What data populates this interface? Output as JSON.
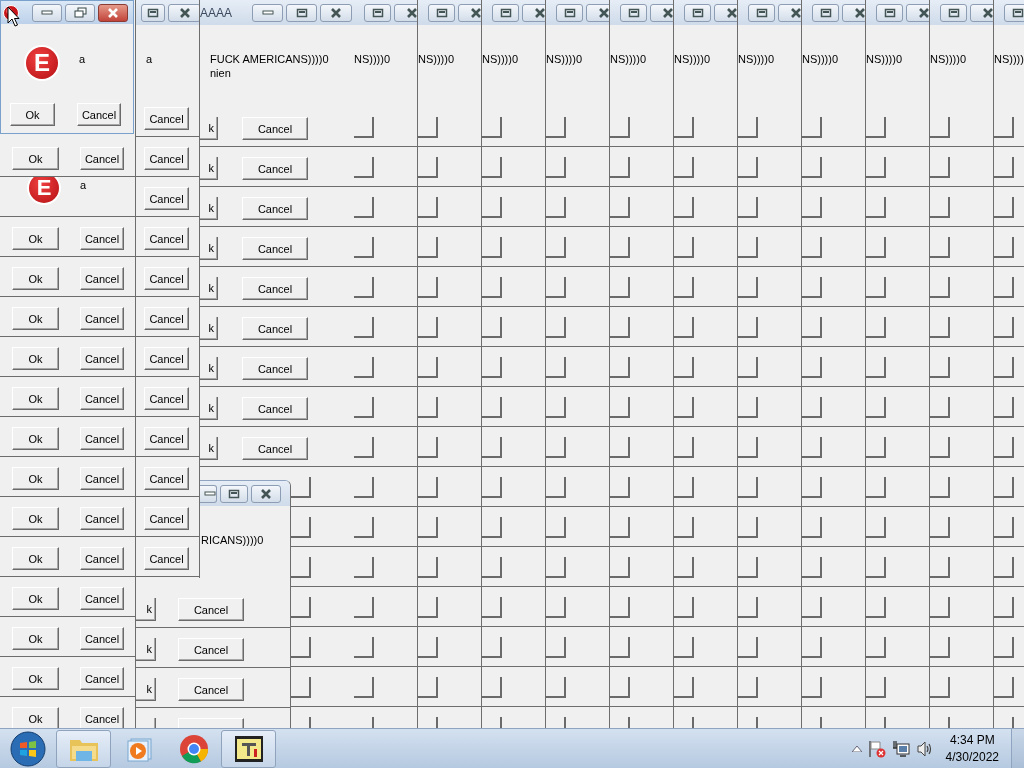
{
  "main_window": {
    "logo": "E",
    "message": "a",
    "buttons": [
      "Ok",
      "Cancel"
    ]
  },
  "left_stack": {
    "rows": [
      {
        "kind": "buttons",
        "buttons": [
          "Ok",
          "Cancel"
        ]
      },
      {
        "kind": "message",
        "logo": "E",
        "message": "a"
      },
      {
        "kind": "buttons",
        "buttons": [
          "Ok",
          "Cancel"
        ]
      },
      {
        "kind": "buttons",
        "buttons": [
          "Ok",
          "Cancel"
        ]
      },
      {
        "kind": "buttons",
        "buttons": [
          "Ok",
          "Cancel"
        ]
      },
      {
        "kind": "buttons",
        "buttons": [
          "Ok",
          "Cancel"
        ]
      },
      {
        "kind": "buttons",
        "buttons": [
          "Ok",
          "Cancel"
        ]
      },
      {
        "kind": "buttons",
        "buttons": [
          "Ok",
          "Cancel"
        ]
      },
      {
        "kind": "buttons",
        "buttons": [
          "Ok",
          "Cancel"
        ]
      },
      {
        "kind": "buttons",
        "buttons": [
          "Ok",
          "Cancel"
        ]
      },
      {
        "kind": "buttons",
        "buttons": [
          "Ok",
          "Cancel"
        ]
      },
      {
        "kind": "buttons",
        "buttons": [
          "Ok",
          "Cancel"
        ]
      },
      {
        "kind": "buttons",
        "buttons": [
          "Ok",
          "Cancel"
        ]
      },
      {
        "kind": "buttons",
        "buttons": [
          "Ok",
          "Cancel"
        ]
      },
      {
        "kind": "buttons",
        "buttons": [
          "Ok",
          "Cancel"
        ]
      }
    ]
  },
  "second_column": {
    "message": "a",
    "buttons": [
      "Cancel",
      "Cancel",
      "Cancel",
      "Cancel",
      "Cancel",
      "Cancel",
      "Cancel",
      "Cancel",
      "Cancel",
      "Cancel",
      "Cancel",
      "Cancel"
    ]
  },
  "aaaa_window": {
    "title": "AAAA",
    "message_lines": [
      "FUCK AMERICANS))))0",
      "nien"
    ],
    "rows": [
      {
        "kind": "buttons",
        "ok": "k",
        "cancel": "Cancel"
      },
      {
        "kind": "buttons",
        "ok": "k",
        "cancel": "Cancel"
      },
      {
        "kind": "buttons",
        "ok": "k",
        "cancel": "Cancel"
      },
      {
        "kind": "buttons",
        "ok": "k",
        "cancel": "Cancel"
      },
      {
        "kind": "buttons",
        "ok": "k",
        "cancel": "Cancel"
      },
      {
        "kind": "buttons",
        "ok": "k",
        "cancel": "Cancel"
      },
      {
        "kind": "buttons",
        "ok": "k",
        "cancel": "Cancel"
      },
      {
        "kind": "buttons",
        "ok": "k",
        "cancel": "Cancel"
      },
      {
        "kind": "buttons",
        "ok": "k",
        "cancel": "Cancel"
      },
      {
        "kind": "stub"
      },
      {
        "kind": "stub"
      },
      {
        "kind": "stub"
      },
      {
        "kind": "stub"
      },
      {
        "kind": "stub"
      },
      {
        "kind": "stub"
      },
      {
        "kind": "stub"
      }
    ]
  },
  "lower_window": {
    "message": "RICANS))))0",
    "rows": [
      {
        "kind": "buttons",
        "ok": "k",
        "cancel": "Cancel"
      },
      {
        "kind": "buttons",
        "ok": "k",
        "cancel": "Cancel"
      },
      {
        "kind": "buttons",
        "ok": "k",
        "cancel": "Cancel"
      },
      {
        "kind": "cut"
      }
    ]
  },
  "columns": [
    {
      "message": "NS))))0"
    },
    {
      "message": "NS))))0"
    },
    {
      "message": "NS))))0"
    },
    {
      "message": "NS))))0"
    },
    {
      "message": "NS))))0"
    },
    {
      "message": "NS))))0"
    },
    {
      "message": "NS))))0"
    },
    {
      "message": "NS))))0"
    },
    {
      "message": "NS))))0"
    },
    {
      "message": "NS))))0"
    },
    {
      "message": "NS))))"
    }
  ],
  "taskbar": {
    "time": "4:34 PM",
    "date": "4/30/2022"
  }
}
